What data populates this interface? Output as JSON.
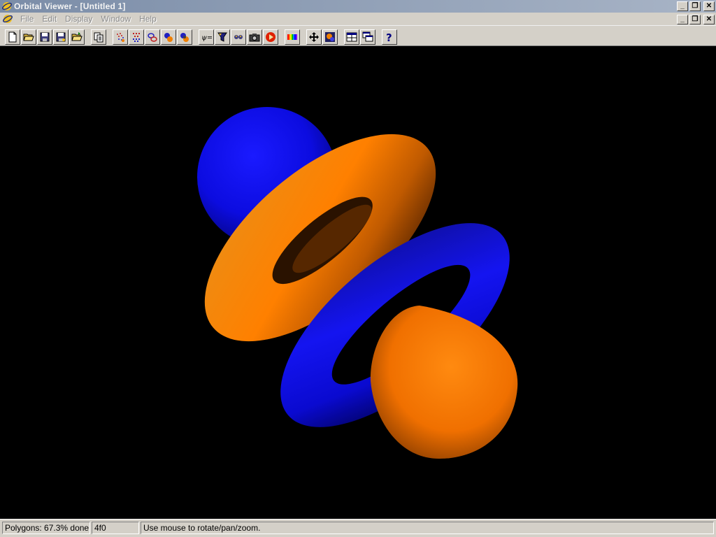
{
  "window": {
    "title": "Orbital Viewer - [Untitled 1]",
    "controls": [
      "minimize",
      "restore",
      "close"
    ]
  },
  "menu": {
    "items": [
      {
        "label": "File"
      },
      {
        "label": "Edit"
      },
      {
        "label": "Display"
      },
      {
        "label": "Window"
      },
      {
        "label": "Help"
      }
    ]
  },
  "toolbar": {
    "buttons": [
      {
        "name": "new-icon"
      },
      {
        "name": "open-icon"
      },
      {
        "name": "save-icon"
      },
      {
        "name": "save-as-icon"
      },
      {
        "name": "open-folder-icon"
      },
      {
        "name": "copy-icon"
      },
      {
        "name": "point-cloud-icon"
      },
      {
        "name": "grid-dots-icon"
      },
      {
        "name": "orbital-lines-icon"
      },
      {
        "name": "orbital-shaded-icon"
      },
      {
        "name": "orbital-solid-icon"
      },
      {
        "name": "equation-icon"
      },
      {
        "name": "filter-icon"
      },
      {
        "name": "stereo-icon"
      },
      {
        "name": "camera-icon"
      },
      {
        "name": "play-icon"
      },
      {
        "name": "color-palette-icon"
      },
      {
        "name": "move-arrows-icon"
      },
      {
        "name": "render-options-icon"
      },
      {
        "name": "tile-windows-icon"
      },
      {
        "name": "cascade-windows-icon"
      },
      {
        "name": "help-icon"
      }
    ]
  },
  "scene": {
    "background": "#000000",
    "positive_color": "#ff7f00",
    "negative_color": "#0a0ae6"
  },
  "status": {
    "progress_text": "Polygons: 67.3% done",
    "progress": 0.673,
    "orbital": "4f0",
    "hint": "Use mouse to rotate/pan/zoom."
  }
}
